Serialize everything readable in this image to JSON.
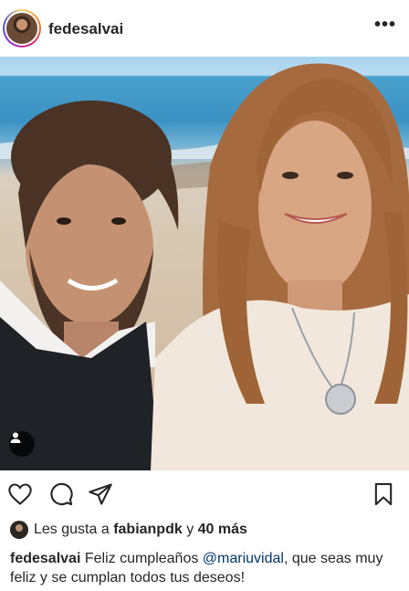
{
  "post": {
    "username": "fedesalvai",
    "more_label": "•••"
  },
  "likes": {
    "prefix": "Les gusta a",
    "first_liker": "fabianpdk",
    "connector": "y",
    "others": "40 más"
  },
  "caption": {
    "username": "fedesalvai",
    "text_before": "Feliz cumpleaños",
    "mention": "@mariuvidal",
    "text_after": ", que seas muy feliz y se cumplan todos tus deseos!"
  },
  "icons": {
    "like": "heart-icon",
    "comment": "comment-icon",
    "share": "send-icon",
    "save": "bookmark-icon",
    "tagged": "person-tag-icon",
    "options": "more-icon"
  },
  "colors": {
    "text": "#262626",
    "mention": "#00376b",
    "background": "#ffffff"
  }
}
